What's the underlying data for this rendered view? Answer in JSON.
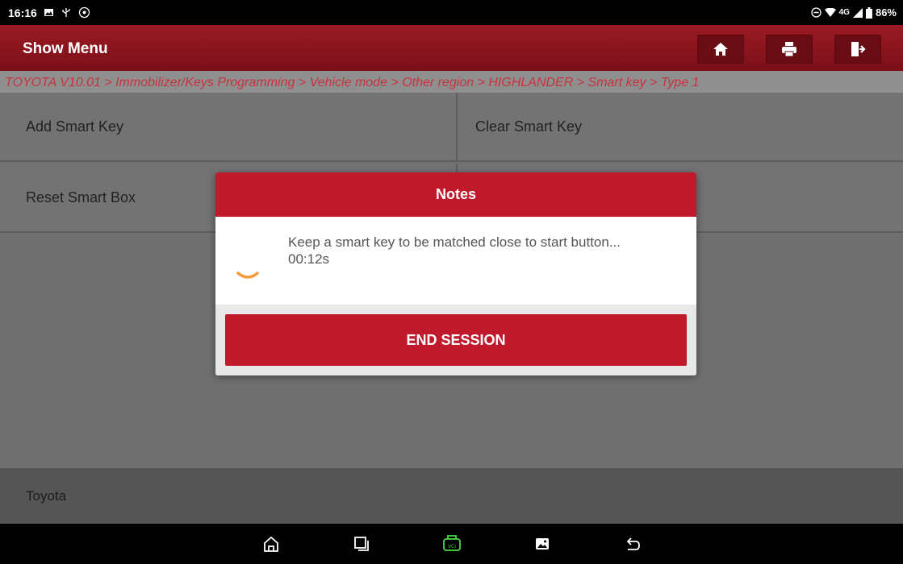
{
  "status_bar": {
    "time": "16:16",
    "network": "4G",
    "battery": "86%"
  },
  "header": {
    "title": "Show Menu",
    "buttons": [
      "home-icon",
      "printer-icon",
      "exit-icon"
    ]
  },
  "breadcrumb": "TOYOTA V10.01 > Immobilizer/Keys Programming > Vehicle mode > Other region > HIGHLANDER > Smart key > Type 1",
  "menu": {
    "items": [
      "Add Smart Key",
      "Clear Smart Key",
      "Reset Smart Box",
      ""
    ]
  },
  "footer": {
    "label": "Toyota"
  },
  "dialog": {
    "title": "Notes",
    "message": "Keep a smart key to be matched close to start button... 00:12s",
    "button": "END SESSION"
  },
  "nav_bar": {
    "buttons": [
      "home-icon",
      "recent-apps-icon",
      "vci-icon",
      "screenshot-icon",
      "back-icon"
    ]
  },
  "colors": {
    "header": "#8a1520",
    "dialog_accent": "#c0192b",
    "breadcrumb_text": "#c7333f",
    "spinner": "#f39c3a"
  }
}
